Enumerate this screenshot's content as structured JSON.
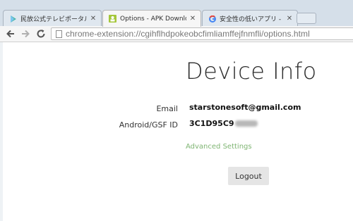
{
  "browser": {
    "tabs": [
      {
        "title": "民放公式テレビポータル「TVe",
        "icon": "play-store-icon",
        "active": false
      },
      {
        "title": "Options - APK Downloader",
        "icon": "android-icon",
        "active": true
      },
      {
        "title": "安全性の低いアプリ - アカウ",
        "icon": "google-icon",
        "active": false
      }
    ],
    "toolbar": {
      "back_icon": "back-arrow-icon",
      "forward_icon": "forward-arrow-icon",
      "reload_icon": "reload-icon"
    },
    "address_bar": {
      "url": "chrome-extension://cgihflhdpokeobcfimliamffejfnmfli/options.html"
    }
  },
  "page": {
    "title": "Device Info",
    "email_label": "Email",
    "email_value": "starstonesoft@gmail.com",
    "device_id_label": "Android/GSF ID",
    "device_id_value": "3C1D95C9",
    "advanced_settings_link": "Advanced Settings",
    "logout_label": "Logout"
  },
  "colors": {
    "link": "#7fb573",
    "button_bg": "#e5e5e5",
    "tabstrip_bg": "#d5dfe9"
  }
}
